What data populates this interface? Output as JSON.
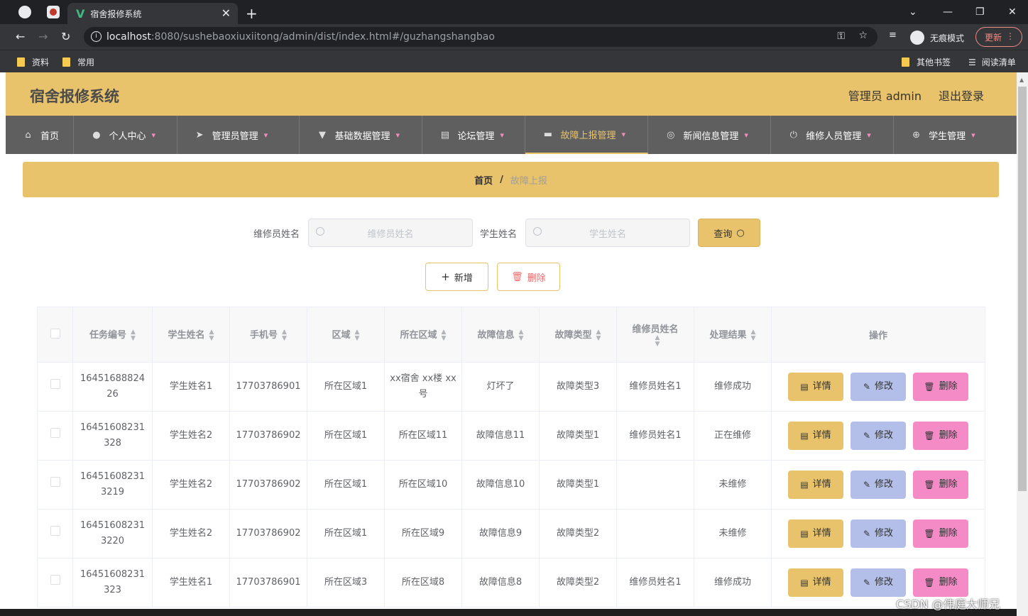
{
  "browser": {
    "tab_title": "宿舍报修系统",
    "url_host": "localhost",
    "url_rest": ":8080/sushebaoxiuxiitong/admin/dist/index.html#/guzhangshangbao",
    "incognito_label": "无痕模式",
    "update_label": "更新",
    "bookmarks": [
      "资料",
      "常用"
    ],
    "bookmarks_right": [
      "其他书签",
      "阅读清单"
    ]
  },
  "header": {
    "title": "宿舍报修系统",
    "user": "管理员 admin",
    "logout": "退出登录"
  },
  "menu": [
    {
      "label": "首页",
      "icon": "home-icon",
      "arrow": false
    },
    {
      "label": "个人中心",
      "icon": "user-icon",
      "arrow": true
    },
    {
      "label": "管理员管理",
      "icon": "send-icon",
      "arrow": true
    },
    {
      "label": "基础数据管理",
      "icon": "data-icon",
      "arrow": true
    },
    {
      "label": "论坛管理",
      "icon": "forum-icon",
      "arrow": true
    },
    {
      "label": "故障上报管理",
      "icon": "monitor-icon",
      "arrow": true,
      "active": true
    },
    {
      "label": "新闻信息管理",
      "icon": "news-icon",
      "arrow": true
    },
    {
      "label": "维修人员管理",
      "icon": "power-icon",
      "arrow": true
    },
    {
      "label": "学生管理",
      "icon": "target-icon",
      "arrow": true
    }
  ],
  "breadcrumb": {
    "home": "首页",
    "separator": "/",
    "current": "故障上报"
  },
  "search": {
    "repair_label": "维修员姓名",
    "repair_placeholder": "维修员姓名",
    "student_label": "学生姓名",
    "student_placeholder": "学生姓名",
    "query_label": "查询"
  },
  "actions": {
    "add": "新增",
    "delete": "删除"
  },
  "table": {
    "headers": [
      "任务编号",
      "学生姓名",
      "手机号",
      "区域",
      "所在区域",
      "故障信息",
      "故障类型",
      "维修员姓名",
      "处理结果",
      "操作"
    ],
    "rows": [
      [
        "1645168882426",
        "学生姓名1",
        "17703786901",
        "所在区域1",
        "xx宿舍 xx楼 xx号",
        "灯坏了",
        "故障类型3",
        "维修员姓名1",
        "维修成功"
      ],
      [
        "16451608231328",
        "学生姓名2",
        "17703786902",
        "所在区域1",
        "所在区域11",
        "故障信息11",
        "故障类型1",
        "维修员姓名1",
        "正在维修"
      ],
      [
        "164516082313219",
        "学生姓名2",
        "17703786902",
        "所在区域1",
        "所在区域10",
        "故障信息10",
        "故障类型1",
        "",
        "未维修"
      ],
      [
        "164516082313220",
        "学生姓名2",
        "17703786902",
        "所在区域1",
        "所在区域9",
        "故障信息9",
        "故障类型2",
        "",
        "未维修"
      ],
      [
        "16451608231323",
        "学生姓名1",
        "17703786901",
        "所在区域3",
        "所在区域8",
        "故障信息8",
        "故障类型2",
        "维修员姓名1",
        "维修成功"
      ]
    ],
    "op_labels": {
      "detail": "详情",
      "edit": "修改",
      "delete": "删除"
    }
  },
  "watermark": "CSDN @伟庭大师兄"
}
